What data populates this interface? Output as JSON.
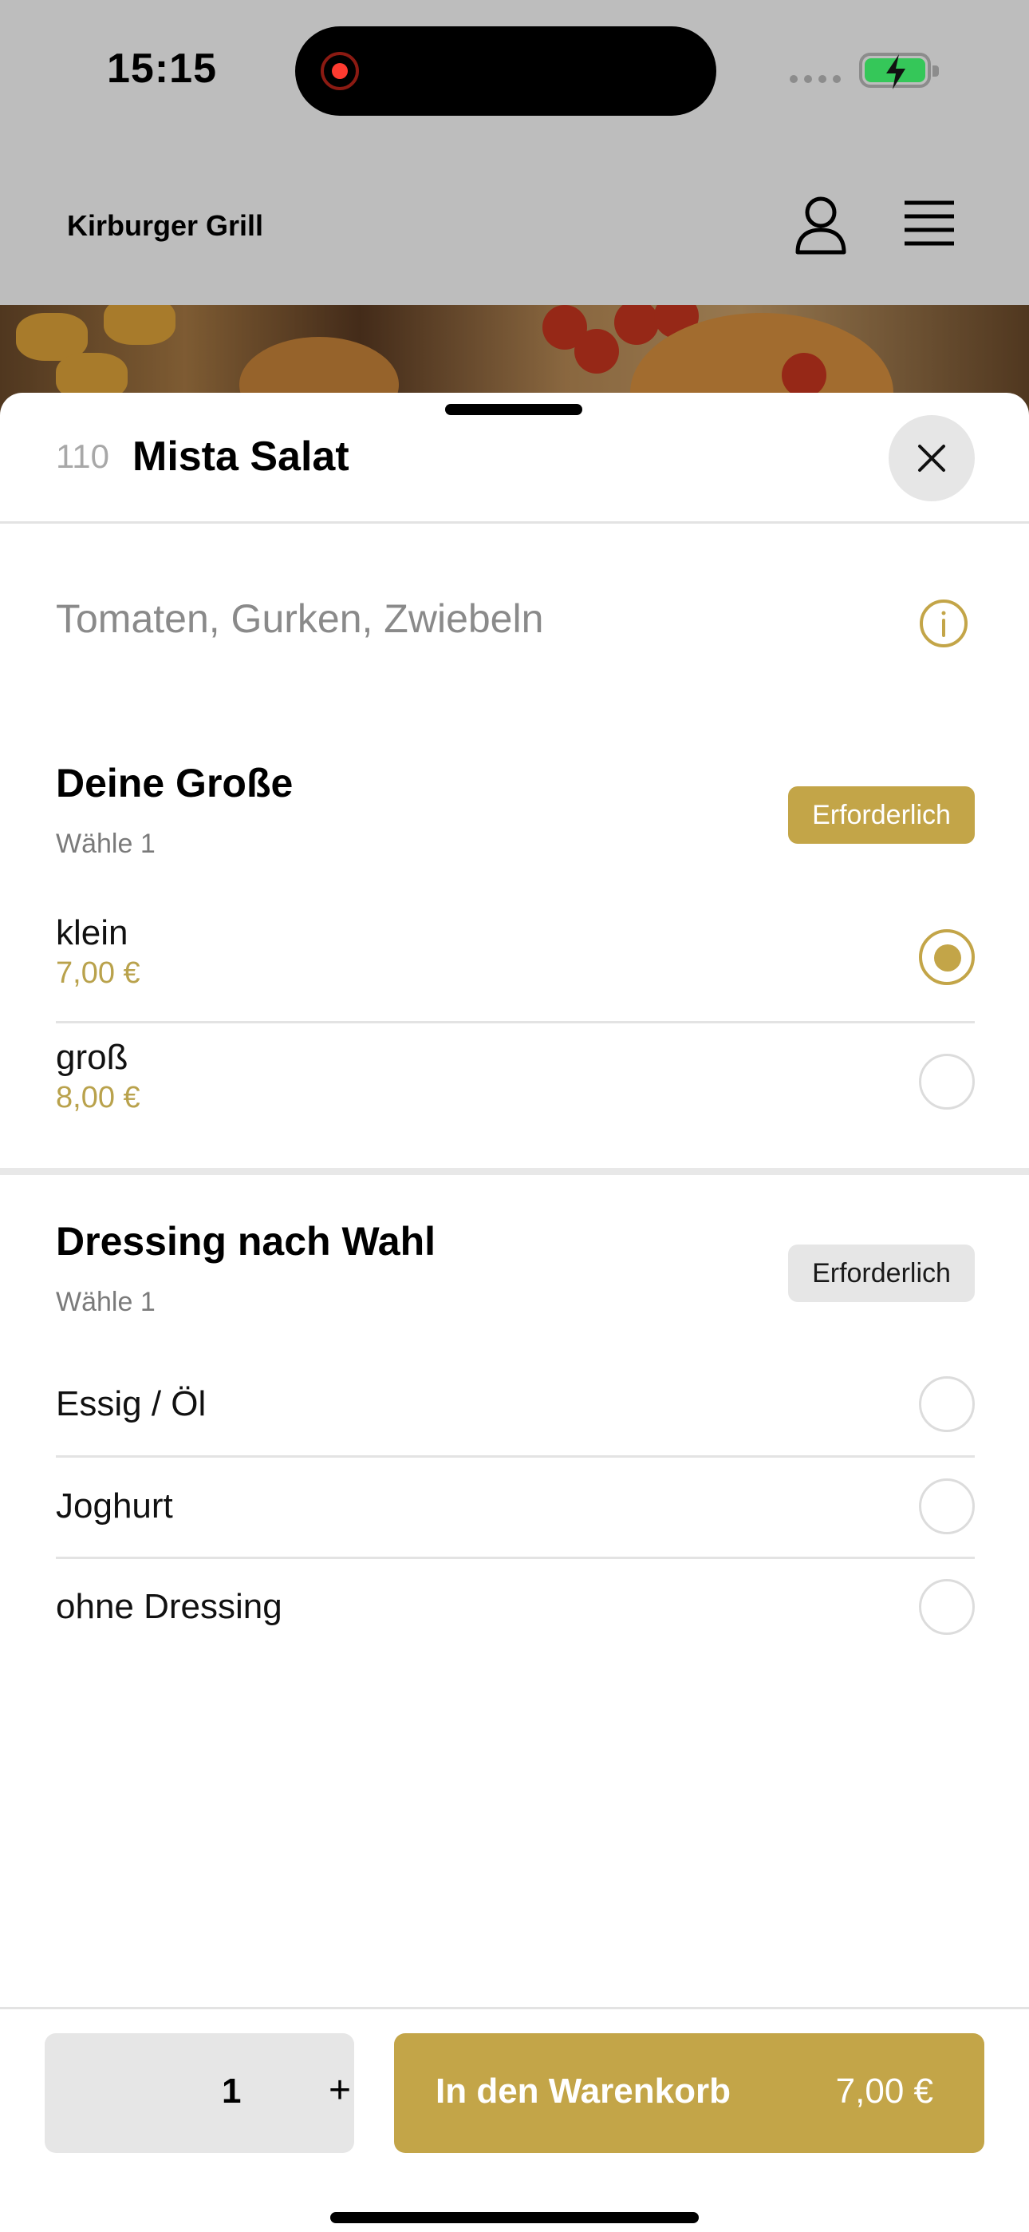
{
  "status_bar": {
    "time": "15:15"
  },
  "app": {
    "title": "Kirburger Grill"
  },
  "item": {
    "number": "110",
    "name": "Mista Salat",
    "description": "Tomaten, Gurken, Zwiebeln"
  },
  "groups": [
    {
      "title": "Deine Große",
      "subtitle": "Wähle 1",
      "badge": "Erforderlich",
      "options": [
        {
          "label": "klein",
          "price": "7,00 €",
          "selected": true
        },
        {
          "label": "groß",
          "price": "8,00 €",
          "selected": false
        }
      ]
    },
    {
      "title": "Dressing nach Wahl",
      "subtitle": "Wähle 1",
      "badge": "Erforderlich",
      "options": [
        {
          "label": "Essig / Öl",
          "selected": false
        },
        {
          "label": "Joghurt",
          "selected": false
        },
        {
          "label": "ohne Dressing",
          "selected": false
        }
      ]
    }
  ],
  "bottom": {
    "quantity": "1",
    "plus": "+",
    "add_to_cart_label": "In den Warenkorb",
    "total": "7,00 €"
  },
  "colors": {
    "accent": "#c3a548",
    "price": "#b9a24c",
    "muted": "#e6e6e6"
  },
  "icons": [
    "user-icon",
    "menu-icon",
    "close-icon",
    "info-icon",
    "battery-charging-icon",
    "recording-icon"
  ]
}
